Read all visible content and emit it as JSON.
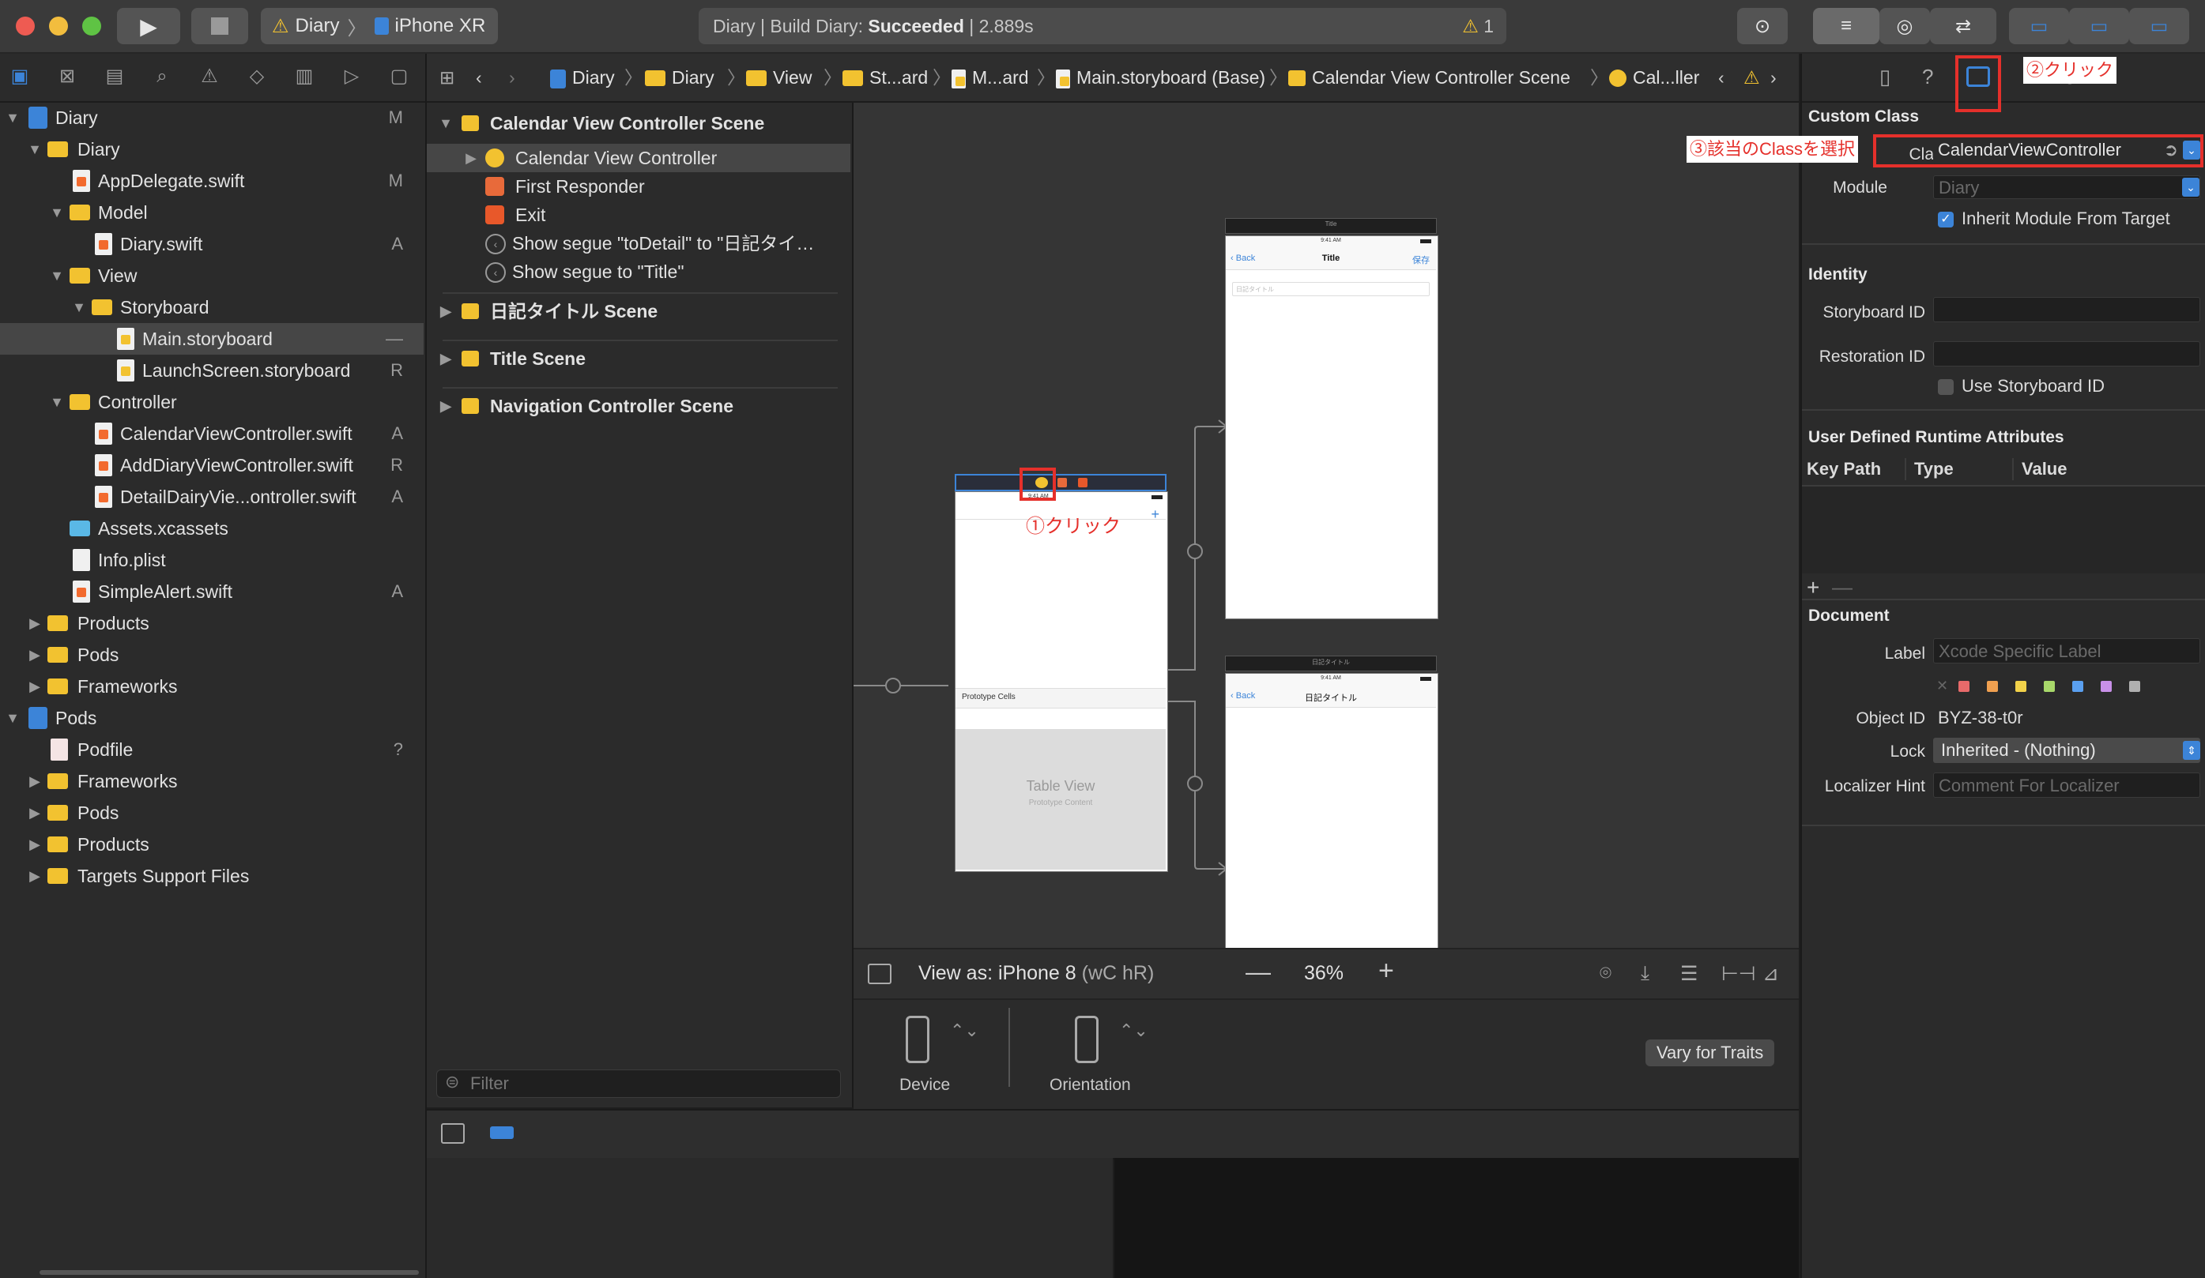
{
  "toolbar": {
    "scheme": "Diary",
    "device": "iPhone XR",
    "status_prefix": "Diary | Build Diary: ",
    "status_result": "Succeeded",
    "status_time": " | 2.889s",
    "warning_count": "1"
  },
  "navigator": {
    "items": [
      {
        "label": "Diary",
        "badge": "M"
      },
      {
        "label": "Diary",
        "badge": ""
      },
      {
        "label": "AppDelegate.swift",
        "badge": "M"
      },
      {
        "label": "Model",
        "badge": ""
      },
      {
        "label": "Diary.swift",
        "badge": "A"
      },
      {
        "label": "View",
        "badge": ""
      },
      {
        "label": "Storyboard",
        "badge": ""
      },
      {
        "label": "Main.storyboard",
        "badge": "—"
      },
      {
        "label": "LaunchScreen.storyboard",
        "badge": "R"
      },
      {
        "label": "Controller",
        "badge": ""
      },
      {
        "label": "CalendarViewController.swift",
        "badge": "A"
      },
      {
        "label": "AddDiaryViewController.swift",
        "badge": "R"
      },
      {
        "label": "DetailDairyVie...ontroller.swift",
        "badge": "A"
      },
      {
        "label": "Assets.xcassets",
        "badge": ""
      },
      {
        "label": "Info.plist",
        "badge": ""
      },
      {
        "label": "SimpleAlert.swift",
        "badge": "A"
      },
      {
        "label": "Products",
        "badge": ""
      },
      {
        "label": "Pods",
        "badge": ""
      },
      {
        "label": "Frameworks",
        "badge": ""
      },
      {
        "label": "Pods",
        "badge": ""
      },
      {
        "label": "Podfile",
        "badge": "?"
      },
      {
        "label": "Frameworks",
        "badge": ""
      },
      {
        "label": "Pods",
        "badge": ""
      },
      {
        "label": "Products",
        "badge": ""
      },
      {
        "label": "Targets Support Files",
        "badge": ""
      }
    ]
  },
  "jumpbar": {
    "crumbs": [
      "Diary",
      "Diary",
      "View",
      "St...ard",
      "M...ard",
      "Main.storyboard (Base)",
      "Calendar View Controller Scene",
      "Cal...ller"
    ]
  },
  "outline": {
    "scene1": "Calendar View Controller Scene",
    "items": [
      "Calendar View Controller",
      "First Responder",
      "Exit",
      "Show segue \"toDetail\" to \"日記タイ…",
      "Show segue to \"Title\""
    ],
    "scene2": "日記タイトル Scene",
    "scene3": "Title Scene",
    "scene4": "Navigation Controller Scene",
    "filter_placeholder": "Filter"
  },
  "canvas": {
    "annotation1": "①クリック",
    "prototype_cells": "Prototype Cells",
    "table_view": "Table View",
    "prototype_content": "Prototype Content",
    "phone2_scene": "Title",
    "phone2_back": "Back",
    "phone2_title": "Title",
    "phone2_save": "保存",
    "phone2_field": "日記タイトル",
    "phone3_scene": "日記タイトル",
    "phone3_back": "Back",
    "phone3_title": "日記タイトル",
    "status_time": "9:41 AM",
    "view_as": "View as: iPhone 8",
    "view_as_traits": "(wC hR)",
    "zoom": "36%",
    "device_label": "Device",
    "orientation_label": "Orientation",
    "vary_for_traits": "Vary for Traits"
  },
  "inspector": {
    "annotation2": "②クリック",
    "annotation3": "③該当のClassを選択",
    "custom_class_header": "Custom Class",
    "class_label": "Class",
    "class_value": "CalendarViewController",
    "module_label": "Module",
    "module_placeholder": "Diary",
    "inherit_label": "Inherit Module From Target",
    "identity_header": "Identity",
    "storyboard_id_label": "Storyboard ID",
    "restoration_id_label": "Restoration ID",
    "use_storyboard_id_label": "Use Storyboard ID",
    "runtime_header": "User Defined Runtime Attributes",
    "col_keypath": "Key Path",
    "col_type": "Type",
    "col_value": "Value",
    "document_header": "Document",
    "label_label": "Label",
    "label_placeholder": "Xcode Specific Label",
    "object_id_label": "Object ID",
    "object_id_value": "BYZ-38-t0r",
    "lock_label": "Lock",
    "lock_value": "Inherited - (Nothing)",
    "localizer_label": "Localizer Hint",
    "localizer_placeholder": "Comment For Localizer"
  },
  "colors": {
    "accent": "#3c84d8",
    "annotation_red": "#e5302b",
    "folder_yellow": "#f2c230",
    "label_swatches": [
      "#e86a6a",
      "#f0a050",
      "#f2d24a",
      "#a8d86a",
      "#5aa0f0",
      "#c890e8",
      "#b0b0b0"
    ]
  }
}
